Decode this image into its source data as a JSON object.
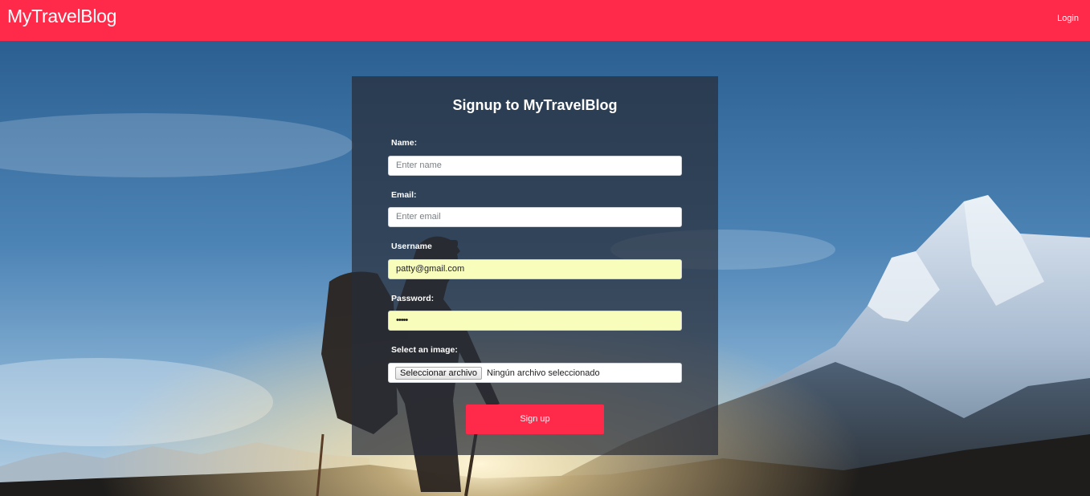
{
  "header": {
    "brand": "MyTravelBlog",
    "login_link": "Login",
    "color": "#ff2a4a"
  },
  "signup_form": {
    "title": "Signup to MyTravelBlog",
    "name": {
      "label": "Name:",
      "placeholder": "Enter name",
      "value": ""
    },
    "email": {
      "label": "Email:",
      "placeholder": "Enter email",
      "value": ""
    },
    "username": {
      "label": "Username",
      "value": "patty@gmail.com"
    },
    "password": {
      "label": "Password:",
      "value": "•••••"
    },
    "image": {
      "label": "Select an image:",
      "button_label": "Seleccionar archivo",
      "status": "Ningún archivo seleccionado"
    },
    "submit_label": "Sign up"
  },
  "colors": {
    "accent": "#ff2a4a",
    "autofill": "#f8fdbb",
    "card_overlay": "rgba(40,45,55,0.72)"
  }
}
